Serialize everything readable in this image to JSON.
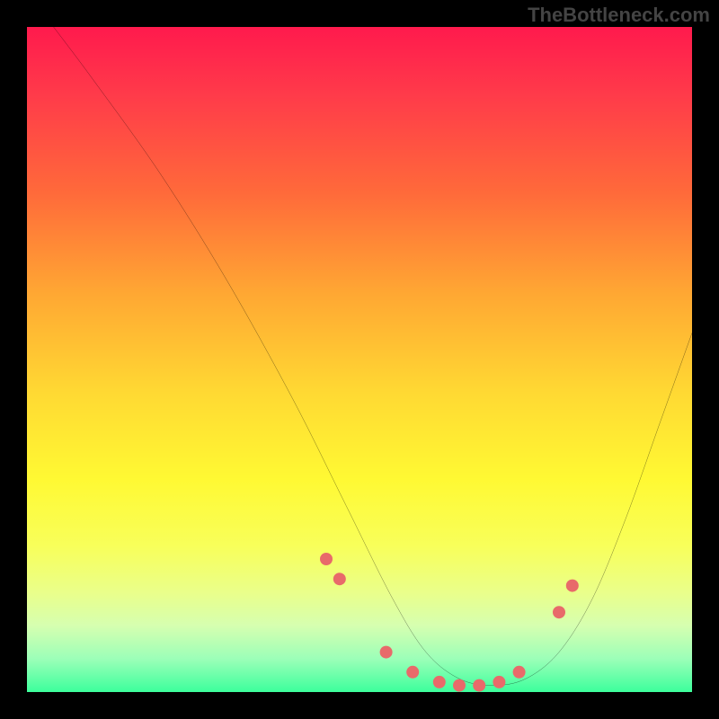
{
  "watermark": "TheBottleneck.com",
  "chart_data": {
    "type": "line",
    "title": "",
    "xlabel": "",
    "ylabel": "",
    "xlim": [
      0,
      100
    ],
    "ylim": [
      0,
      100
    ],
    "grid": false,
    "legend": false,
    "series": [
      {
        "name": "bottleneck-curve",
        "color": "#000000",
        "x": [
          4,
          10,
          20,
          30,
          40,
          48,
          55,
          60,
          65,
          70,
          75,
          80,
          85,
          90,
          95,
          100
        ],
        "y": [
          100,
          92,
          78,
          62,
          44,
          28,
          14,
          6,
          2,
          1,
          2,
          6,
          14,
          26,
          40,
          54
        ]
      }
    ],
    "markers": {
      "name": "highlight-points",
      "color": "#e86a6a",
      "radius": 7,
      "x": [
        45,
        47,
        54,
        58,
        62,
        65,
        68,
        71,
        74,
        80,
        82
      ],
      "y": [
        20,
        17,
        6,
        3,
        1.5,
        1,
        1,
        1.5,
        3,
        12,
        16
      ]
    },
    "background_gradient": {
      "top": "#ff1a4d",
      "middle": "#ffd933",
      "bottom": "#3cff9c"
    }
  }
}
